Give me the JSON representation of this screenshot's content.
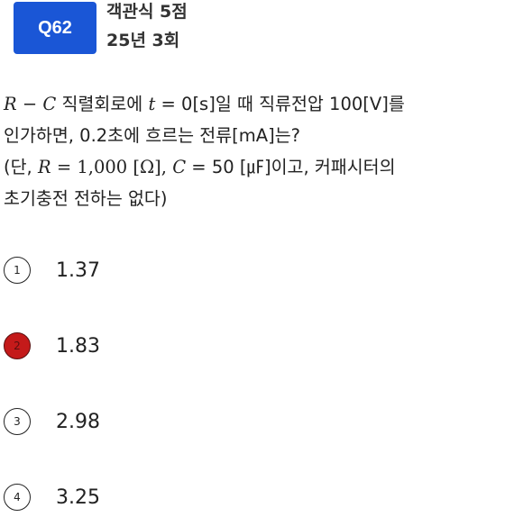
{
  "header": {
    "badge": "Q62",
    "line1": "객관식 5점",
    "line2": "25년 3회"
  },
  "question": {
    "l1_math": "R − C",
    "l1_a": " 직렬회로에 ",
    "l1_math2": "t",
    "l1_b": " = 0[s]일 때 직류전압 100[V]를",
    "l2": "인가하면, 0.2초에 흐르는 전류[mA]는?",
    "l3_a": "(단, ",
    "l3_math": "R",
    "l3_b": " = 1,000 [Ω],  ",
    "l3_math2": "C",
    "l3_c": " = 50 [㎌]이고, 커패시터의",
    "l4": "초기충전 전하는 없다)"
  },
  "options": [
    {
      "num": "1",
      "text": "1.37",
      "selected": false
    },
    {
      "num": "2",
      "text": "1.83",
      "selected": true
    },
    {
      "num": "3",
      "text": "2.98",
      "selected": false
    },
    {
      "num": "4",
      "text": "3.25",
      "selected": false
    }
  ],
  "colors": {
    "badge": "#1a56d6",
    "selected": "#c41a1a"
  }
}
